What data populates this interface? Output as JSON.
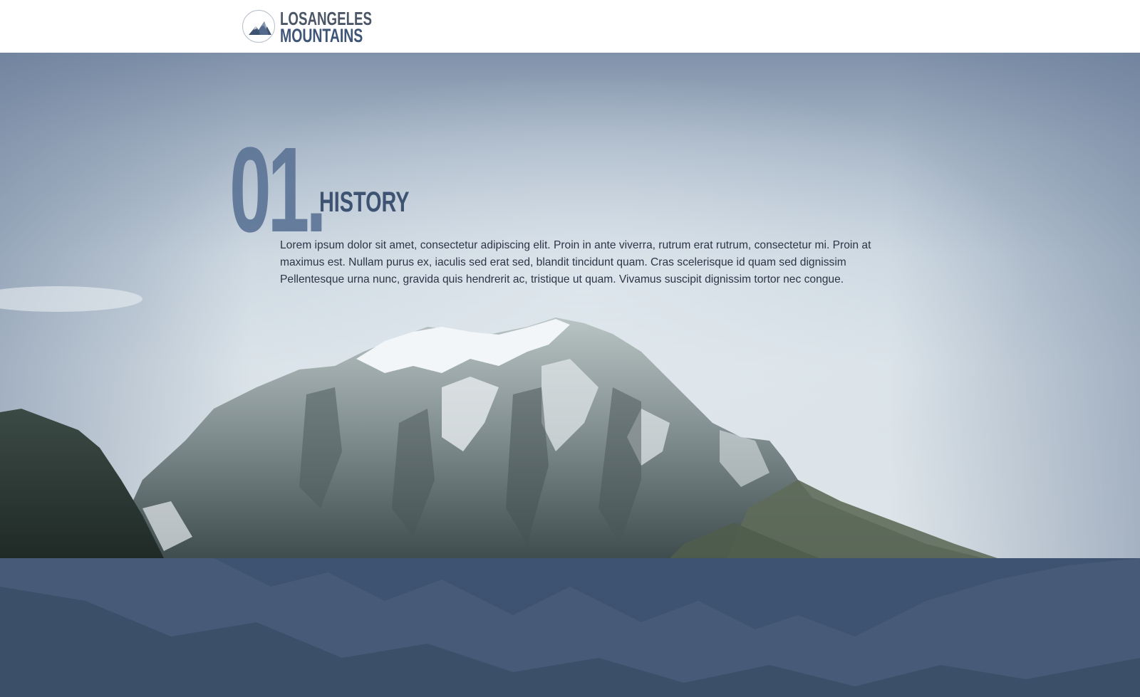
{
  "header": {
    "logo": {
      "line1": "LOSANGELES",
      "line2": "MOUNTAINS",
      "icon": "mountain-logo-icon"
    }
  },
  "section": {
    "number": "01.",
    "title": "HISTORY",
    "body": "Lorem ipsum dolor sit amet, consectetur adipiscing elit. Proin in ante viverra, rutrum erat rutrum, consectetur mi. Proin at maximus est. Nullam purus ex, iaculis sed erat sed, blandit tincidunt quam. Cras scelerisque id quam sed dignissim Pellentesque urna nunc, gravida quis hendrerit ac, tristique ut quam. Vivamus suscipit dignissim tortor nec congue."
  },
  "colors": {
    "accent": "#3e5272",
    "number": "#5d7597",
    "header_bg": "#ffffff",
    "text": "#2c3446"
  }
}
